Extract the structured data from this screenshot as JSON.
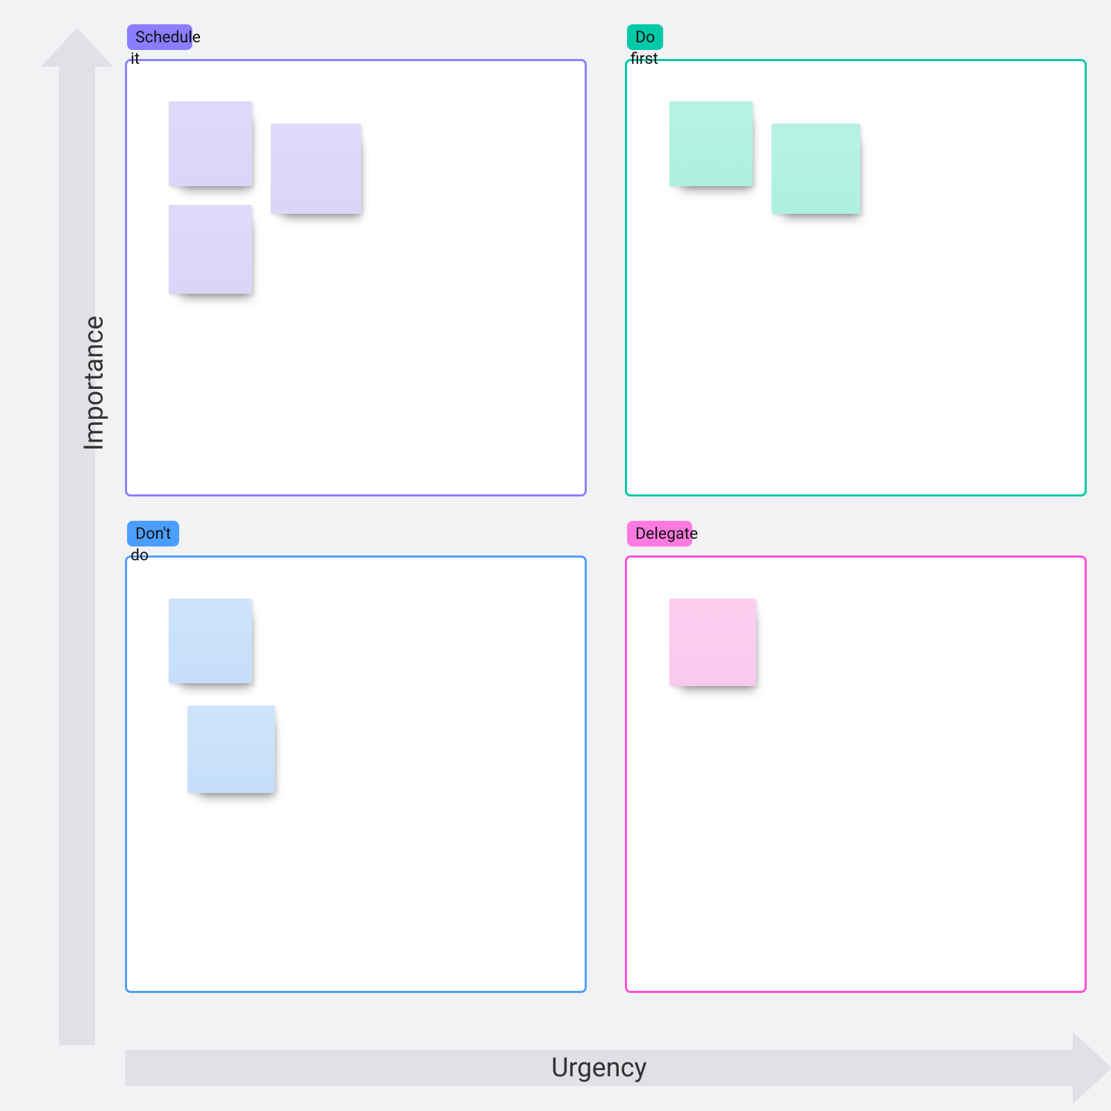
{
  "axes": {
    "y_label": "Importance",
    "x_label": "Urgency"
  },
  "quadrants": {
    "schedule": {
      "label_line1": "Schedule",
      "label_line2": "it",
      "border_color": "#8a7dff",
      "tab_color": "#8a7dff",
      "sticky_count": 3,
      "sticky_color": "purple"
    },
    "do_first": {
      "label_line1": "Do",
      "label_line2": "first",
      "border_color": "#00c9a7",
      "tab_color": "#00c9a7",
      "sticky_count": 2,
      "sticky_color": "teal"
    },
    "dont_do": {
      "label_line1": "Don't",
      "label_line2": "do",
      "border_color": "#4a9eff",
      "tab_color": "#4a9eff",
      "sticky_count": 2,
      "sticky_color": "blue"
    },
    "delegate": {
      "label_line1": "Delegate",
      "label_line2": "",
      "border_color": "#ff4dd8",
      "tab_color": "#ff7ae0",
      "sticky_count": 1,
      "sticky_color": "pink"
    }
  }
}
